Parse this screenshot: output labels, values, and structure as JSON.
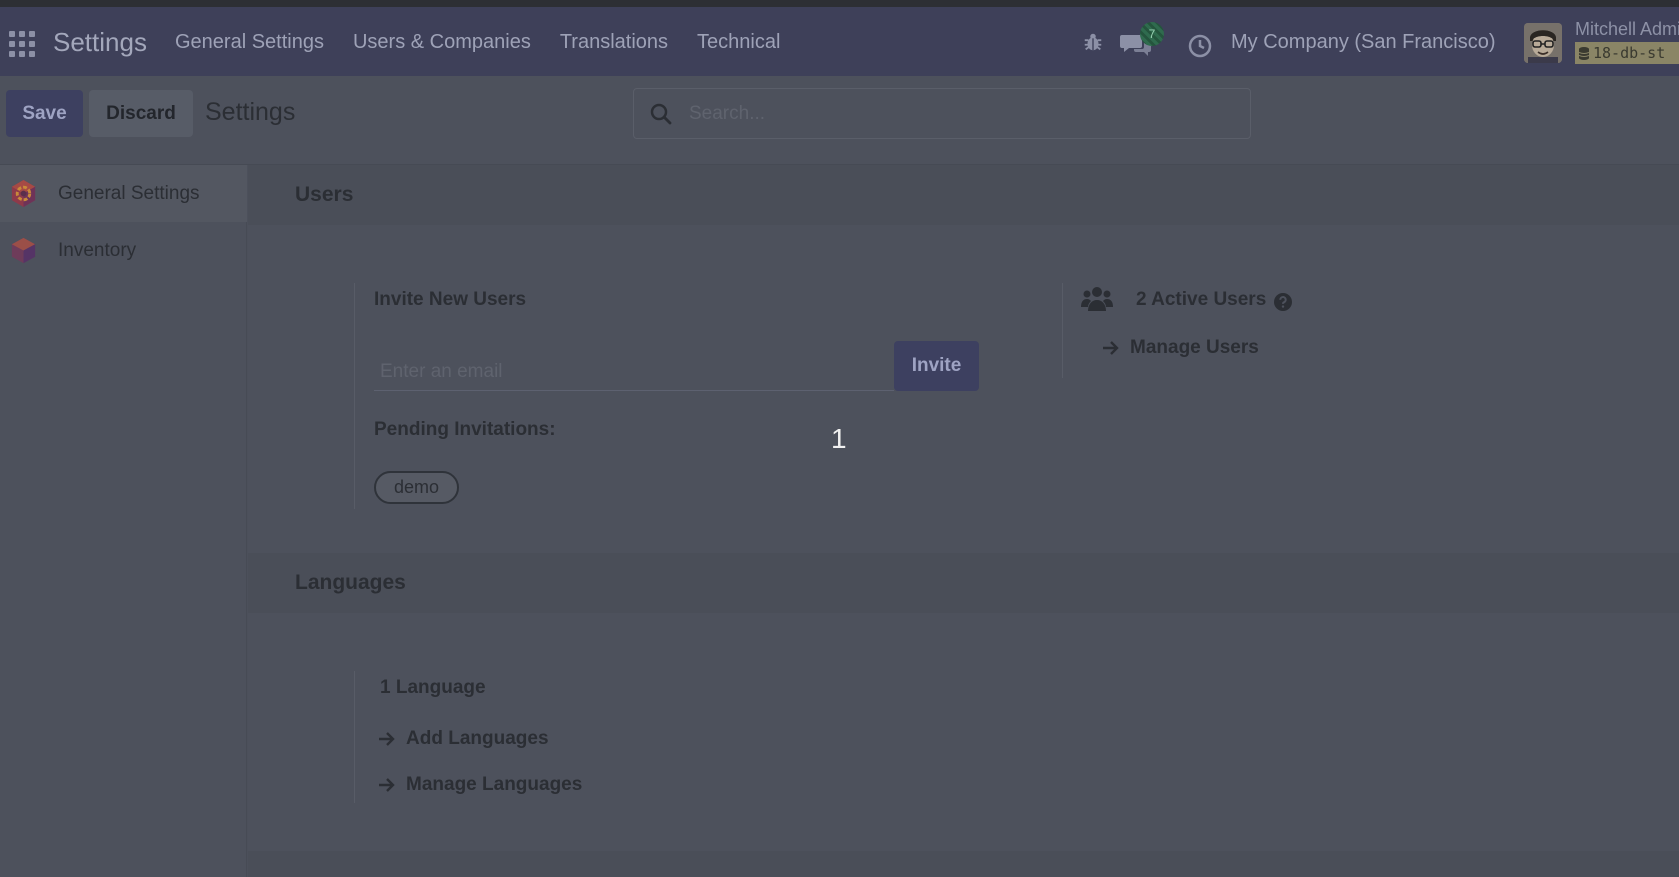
{
  "navbar": {
    "brand": "Settings",
    "menu": [
      "General Settings",
      "Users & Companies",
      "Translations",
      "Technical"
    ],
    "chat_badge": "7",
    "company": "My Company (San Francisco)",
    "user_name": "Mitchell Admin",
    "db_tag": "18-db-st"
  },
  "control_panel": {
    "save_label": "Save",
    "discard_label": "Discard",
    "title": "Settings",
    "search_placeholder": "Search..."
  },
  "sidebar": {
    "items": [
      {
        "label": "General Settings",
        "icon": "general-settings-icon",
        "active": true
      },
      {
        "label": "Inventory",
        "icon": "inventory-icon",
        "active": false
      }
    ]
  },
  "users_section": {
    "title": "Users",
    "invite_label": "Invite New Users",
    "email_placeholder": "Enter an email",
    "invite_button": "Invite",
    "pending_label": "Pending Invitations:",
    "pending_tag": "demo",
    "active_users": "2 Active Users",
    "manage_users": "Manage Users"
  },
  "overlay_marker": "1",
  "languages_section": {
    "title": "Languages",
    "count_label": "1 Language",
    "add_languages": "Add Languages",
    "manage_languages": "Manage Languages"
  },
  "colors": {
    "navbar": "#3e4059",
    "primary_button": "#3d4060",
    "background": "#4d515c"
  }
}
